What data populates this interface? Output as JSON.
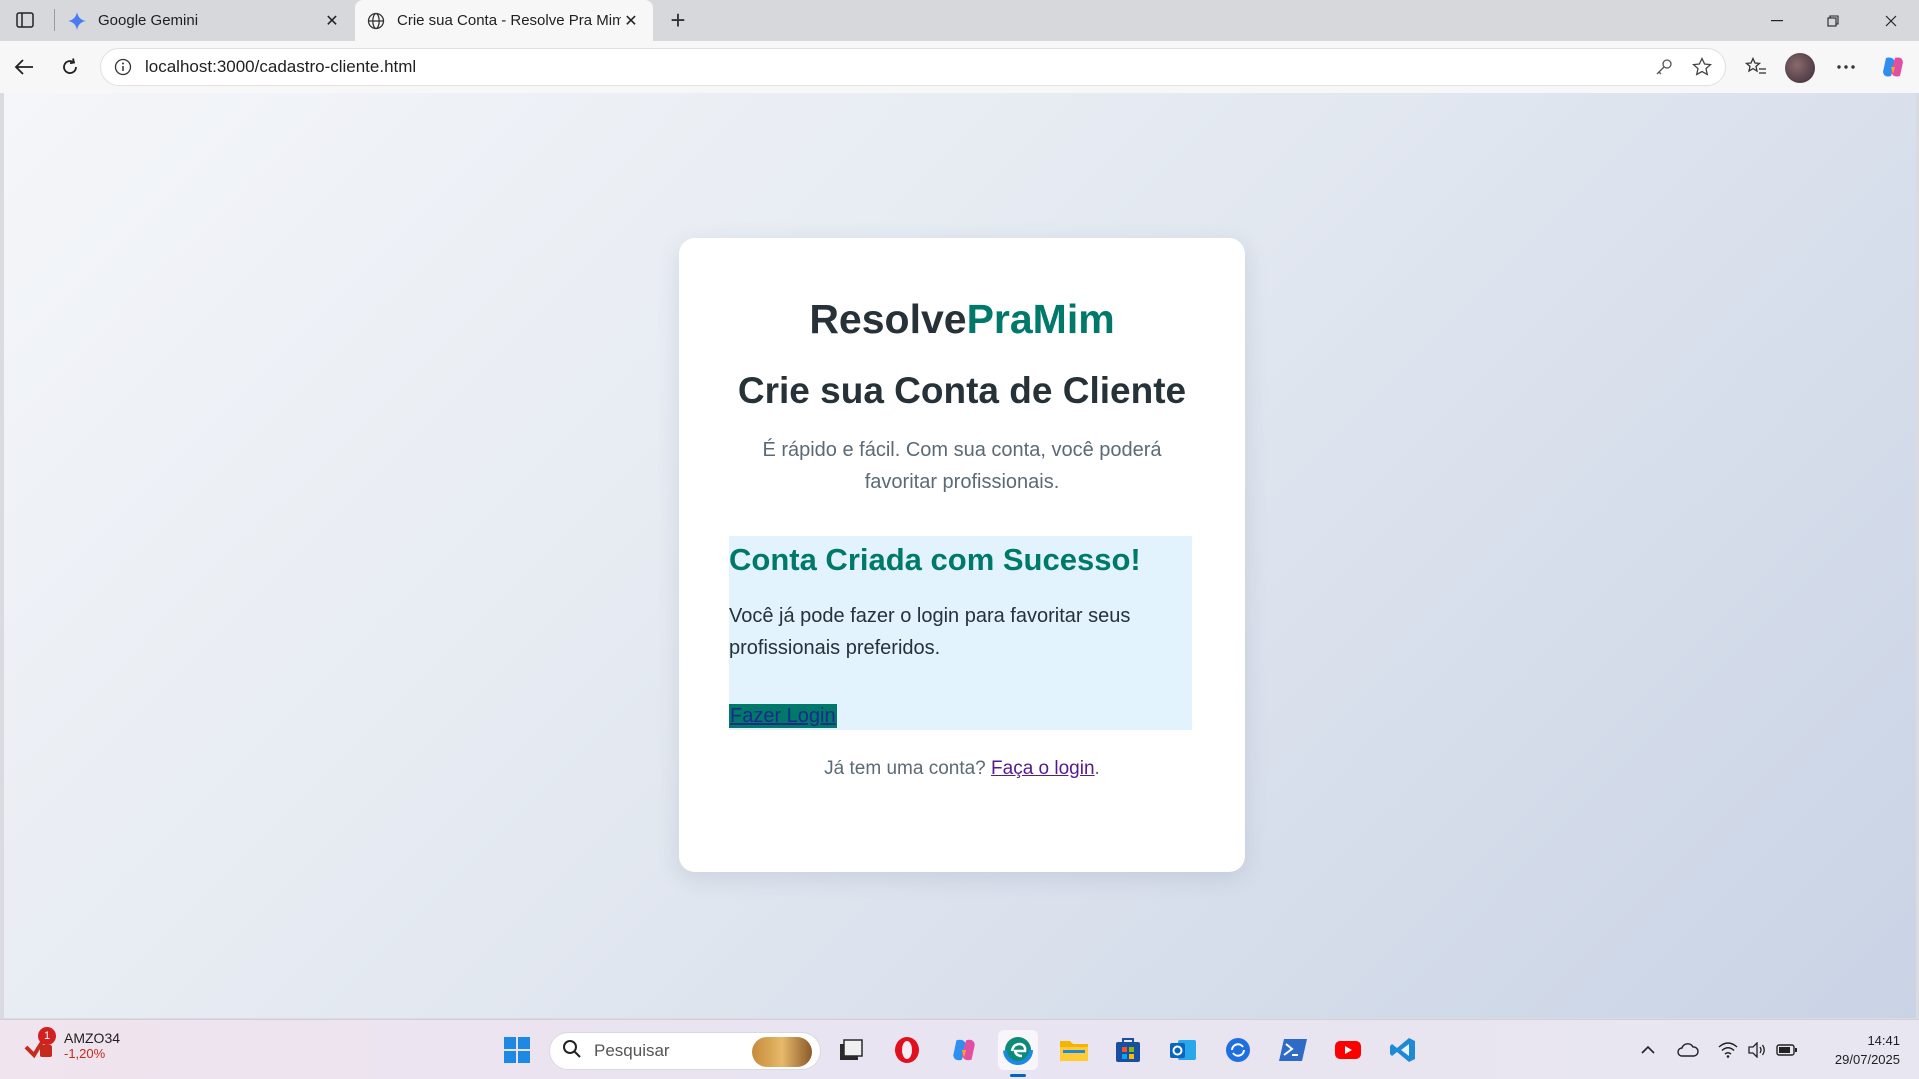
{
  "browser": {
    "tabs": [
      {
        "label": "Google Gemini",
        "icon": "gemini-icon",
        "active": false
      },
      {
        "label": "Crie sua Conta - Resolve Pra Mim",
        "icon": "globe-icon",
        "active": true
      }
    ],
    "address_bar": {
      "url": "localhost:3000/cadastro-cliente.html"
    }
  },
  "page": {
    "brand_part1": "Resolve",
    "brand_part2": "PraMim",
    "title": "Crie sua Conta de Cliente",
    "subtitle": "É rápido e fácil. Com sua conta, você poderá favoritar profissionais.",
    "success": {
      "title": "Conta Criada com Sucesso!",
      "message": "Você já pode fazer o login para favoritar seus profissionais preferidos.",
      "link_label": "Fazer Login"
    },
    "footer": {
      "prefix": "Já tem uma conta?",
      "link_label": "Faça o login",
      "suffix": "."
    },
    "colors": {
      "brand_accent": "#00796b",
      "text_dark": "#263238",
      "success_bg": "#e2f3fd"
    }
  },
  "taskbar": {
    "stock": {
      "symbol": "AMZO34",
      "change": "-1,20%",
      "badge": "1"
    },
    "search_placeholder": "Pesquisar",
    "clock": {
      "time": "14:41",
      "date": "29/07/2025"
    }
  }
}
